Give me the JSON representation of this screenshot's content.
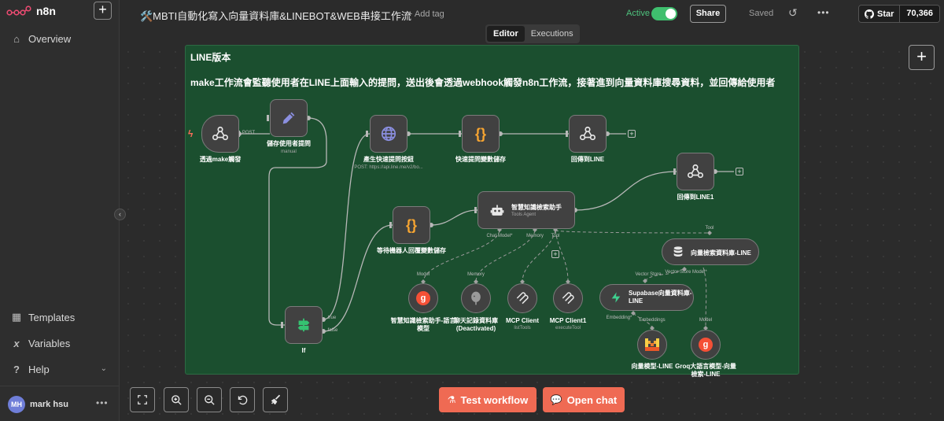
{
  "app": {
    "name": "n8n",
    "new_button": "+"
  },
  "sidebar": {
    "top_items": [
      {
        "label": "Overview",
        "icon": "home-icon"
      }
    ],
    "bottom_items": [
      {
        "label": "Templates",
        "icon": "templates-icon"
      },
      {
        "label": "Variables",
        "icon": "variables-icon"
      },
      {
        "label": "Help",
        "icon": "help-icon"
      }
    ],
    "collapse_glyph": "‹",
    "user": {
      "initials": "MH",
      "name": "mark hsu",
      "more": "•••"
    }
  },
  "header": {
    "title": "🛠️MBTI自動化寫入向量資料庫&LINEBOT&WEB串接工作流",
    "add_tag": "+ Add tag",
    "active_label": "Active",
    "active": true,
    "share": "Share",
    "saved": "Saved",
    "more": "•••",
    "github": {
      "label": "Star",
      "count": "70,366"
    }
  },
  "tabs": [
    {
      "label": "Editor",
      "selected": true
    },
    {
      "label": "Executions",
      "selected": false
    }
  ],
  "sticky_note": {
    "heading": "LINE版本",
    "body": "make工作流會監聽使用者在LINE上面輸入的提問，送出後會透過webhook觸發n8n工作流，接著進到向量資料庫搜尋資料，並回傳給使用者"
  },
  "nodes": {
    "webhook": {
      "label": "透過make觸發"
    },
    "save": {
      "label": "儲存使用者提問",
      "sub": "manual"
    },
    "http": {
      "label": "產生快速提問按鈕",
      "sub": "POST: https://api.line.me/v2/bo..."
    },
    "quick": {
      "label": "快速提問變數儲存"
    },
    "reply": {
      "label": "回傳到LINE"
    },
    "reply1": {
      "label": "回傳到LINE1"
    },
    "agent": {
      "label": "智慧知識檢索助手",
      "sub": "Tools Agent"
    },
    "wait": {
      "label": "等待機器人回覆變數儲存"
    },
    "if": {
      "label": "If"
    },
    "model": {
      "label": "智慧知識檢索助手-語言模型"
    },
    "memory": {
      "label": "聊天記錄資料庫 (Deactivated)"
    },
    "mcp": {
      "label": "MCP Client",
      "sub": "listTools"
    },
    "mcp1": {
      "label": "MCP Client1",
      "sub": "executeTool"
    },
    "vector": {
      "label": "向量檢索資料庫-LINE"
    },
    "supabase": {
      "label": "Supabase向量資料庫-LINE"
    },
    "embed": {
      "label": "向量模型-LINE"
    },
    "groq": {
      "label": "Groq大語言模型-向量檢索-LINE"
    }
  },
  "pins": {
    "post": "POST",
    "true": "true",
    "false": "false",
    "chat_model": "Chat Model*",
    "memory": "Memory",
    "tool": "Tool",
    "model": "Model",
    "vector_store": "Vector Store",
    "vector_store_model": "Vector Store Model*",
    "embedding": "Embedding*",
    "embeddings": "Embeddings"
  },
  "footer": {
    "test_workflow": "Test workflow",
    "open_chat": "Open chat"
  },
  "colors": {
    "accent": "#ef6a53",
    "sticky_bg": "#1b4f2f",
    "active": "#3fbf6e",
    "trigger": "#ff6d5a"
  }
}
